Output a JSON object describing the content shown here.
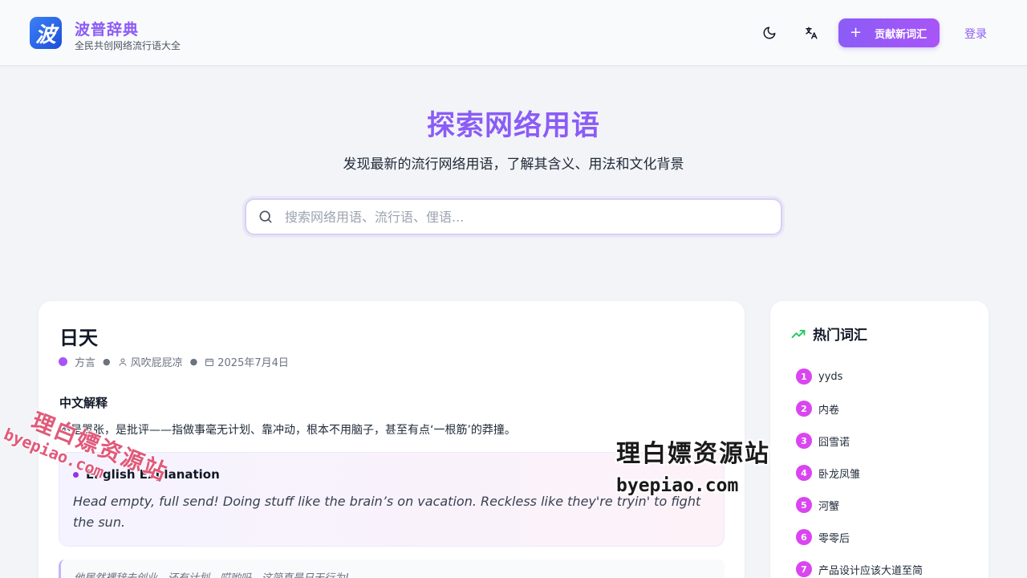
{
  "header": {
    "logo_char": "波",
    "brand_title": "波普辞典",
    "brand_subtitle": "全民共创网络流行语大全",
    "theme_toggle_icon": "moon-icon",
    "language_toggle_icon": "translate-icon",
    "contribute_label": "贡献新词汇",
    "login_label": "登录"
  },
  "hero": {
    "title": "探索网络用语",
    "subtitle": "发现最新的流行网络用语，了解其含义、用法和文化背景",
    "search_placeholder": "搜索网络用语、流行语、俚语..."
  },
  "entry": {
    "word": "日天",
    "category": "方言",
    "author": "风吹屁屁凉",
    "date": "2025年7月4日",
    "zh_label": "中文解释",
    "zh_text": "不是嚣张，是批评——指做事毫无计划、靠冲动，根本不用脑子，甚至有点‘一根筋’的莽撞。",
    "en_label": "English Explanation",
    "en_text": "Head empty, full send! Doing stuff like the brain’s on vacation. Reckless like they're tryin' to fight the sun.",
    "example_text": "他居然裸辞去创业，还有计划，哎哟吗，这简直是日天行为!"
  },
  "hot": {
    "title": "热门词汇",
    "items": [
      {
        "rank": "1",
        "label": "yyds"
      },
      {
        "rank": "2",
        "label": "内卷"
      },
      {
        "rank": "3",
        "label": "囧雪诺"
      },
      {
        "rank": "4",
        "label": "卧龙凤雏"
      },
      {
        "rank": "5",
        "label": "河蟹"
      },
      {
        "rank": "6",
        "label": "零零后"
      },
      {
        "rank": "7",
        "label": "产品设计应该大道至简"
      }
    ]
  },
  "watermark": {
    "cn": "理白嫖资源站",
    "url": "byepiao.com"
  },
  "colors": {
    "accent": "#8b5cf6",
    "rank_badge": "#d946ef",
    "trend_icon": "#22c55e"
  }
}
